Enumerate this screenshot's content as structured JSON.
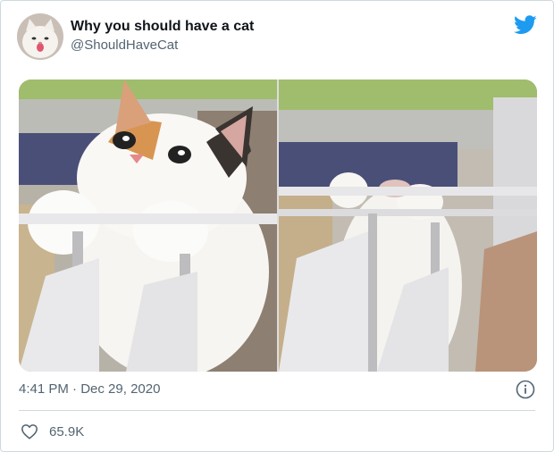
{
  "tweet": {
    "display_name": "Why you should have a cat",
    "handle": "@ShouldHaveCat",
    "time": "4:41 PM",
    "separator": "·",
    "date": "Dec 29, 2020",
    "like_count": "65.9K"
  },
  "colors": {
    "twitter_blue": "#1d9bf0",
    "text_primary": "#0f1419",
    "text_secondary": "#536471",
    "divider": "#cfd9de"
  },
  "icons": {
    "brand": "twitter-bird-icon",
    "info": "info-circle-icon",
    "like": "heart-outline-icon"
  }
}
